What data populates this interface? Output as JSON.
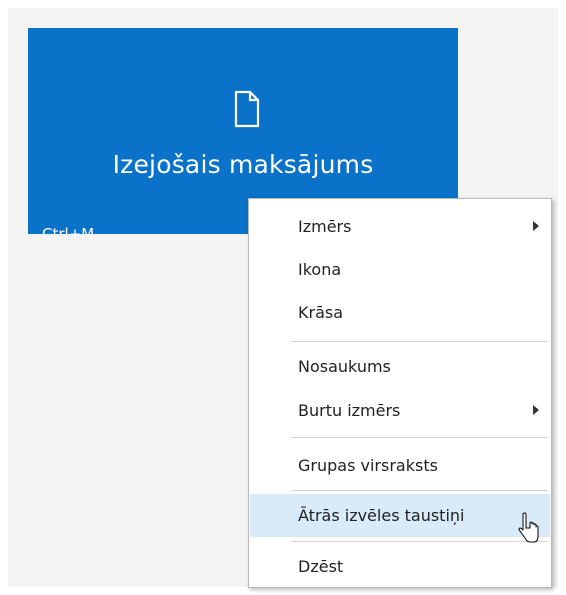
{
  "tile": {
    "title": "Izejošais maksājums",
    "shortcut": "Ctrl+M",
    "icon": "document-icon",
    "color": "#0a73c9"
  },
  "context_menu": {
    "items": [
      {
        "label": "Izmērs",
        "has_submenu": true
      },
      {
        "label": "Ikona",
        "has_submenu": false
      },
      {
        "label": "Krāsa",
        "has_submenu": false
      },
      {
        "label": "Nosaukums",
        "has_submenu": false
      },
      {
        "label": "Burtu izmērs",
        "has_submenu": true
      },
      {
        "label": "Grupas virsraksts",
        "has_submenu": false
      },
      {
        "label": "Ātrās izvēles taustiņi",
        "has_submenu": false,
        "highlighted": true
      },
      {
        "label": "Dzēst",
        "has_submenu": false
      }
    ],
    "highlight_color": "#d9ebf9"
  },
  "cursor": {
    "icon": "mouse-pointer-icon"
  }
}
